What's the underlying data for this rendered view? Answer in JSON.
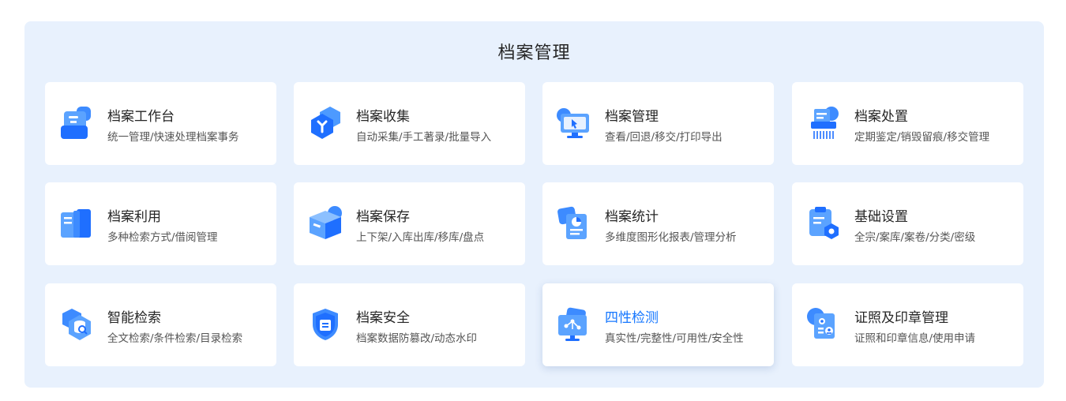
{
  "module": {
    "title": "档案管理"
  },
  "colors": {
    "accent": "#1677ff",
    "panel_bg": "#e8f1fd",
    "card_bg": "#ffffff"
  },
  "cards": [
    {
      "title": "档案工作台",
      "desc": "统一管理/快速处理档案事务",
      "icon": "workbench-icon"
    },
    {
      "title": "档案收集",
      "desc": "自动采集/手工著录/批量导入",
      "icon": "collect-icon"
    },
    {
      "title": "档案管理",
      "desc": "查看/回退/移交/打印导出",
      "icon": "monitor-cursor-icon"
    },
    {
      "title": "档案处置",
      "desc": "定期鉴定/销毁留痕/移交管理",
      "icon": "shredder-icon"
    },
    {
      "title": "档案利用",
      "desc": "多种检索方式/借阅管理",
      "icon": "open-book-icon"
    },
    {
      "title": "档案保存",
      "desc": "上下架/入库出库/移库/盘点",
      "icon": "storage-box-icon"
    },
    {
      "title": "档案统计",
      "desc": "多维度图形化报表/管理分析",
      "icon": "report-chart-icon"
    },
    {
      "title": "基础设置",
      "desc": "全宗/案库/案卷/分类/密级",
      "icon": "clipboard-settings-icon"
    },
    {
      "title": "智能检索",
      "desc": "全文检索/条件检索/目录检索",
      "icon": "database-search-icon"
    },
    {
      "title": "档案安全",
      "desc": "档案数据防篡改/动态水印",
      "icon": "shield-lock-icon"
    },
    {
      "title": "四性检测",
      "desc": "真实性/完整性/可用性/安全性",
      "icon": "network-monitor-icon",
      "active": true
    },
    {
      "title": "证照及印章管理",
      "desc": "证照和印章信息/使用申请",
      "icon": "certificate-stamp-icon"
    }
  ]
}
